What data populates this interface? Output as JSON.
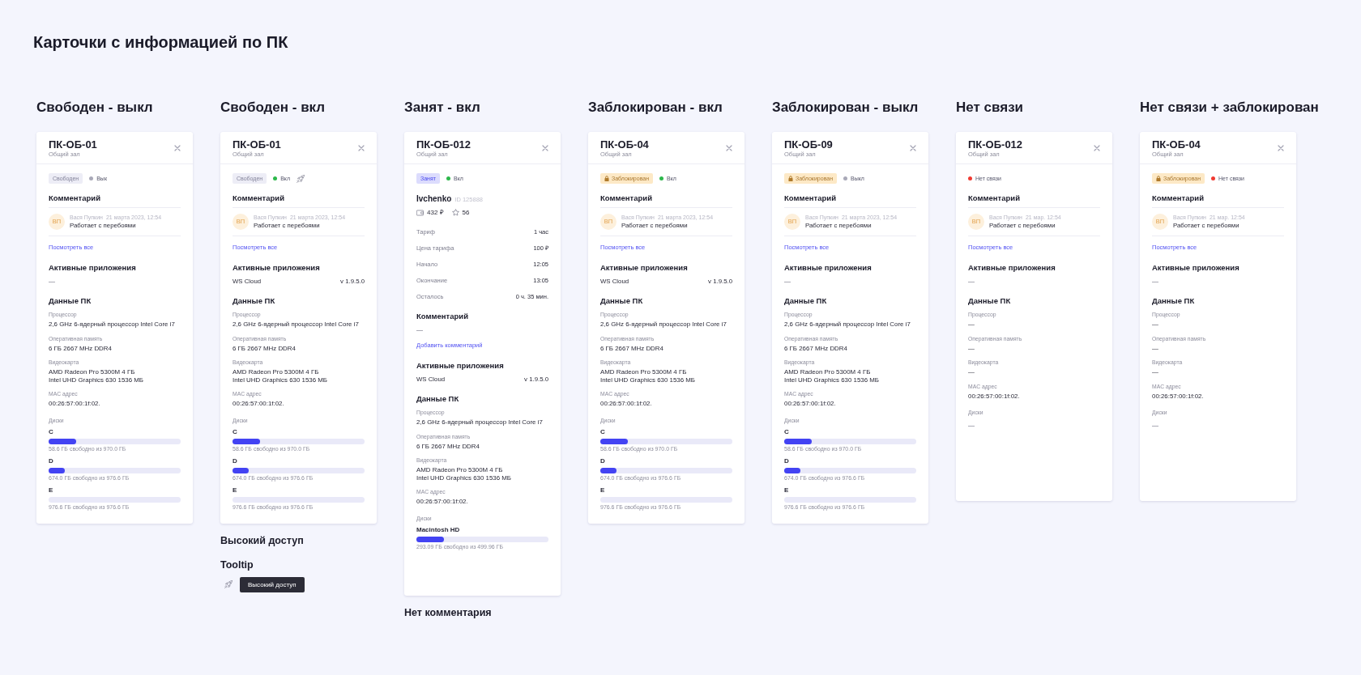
{
  "title": "Карточки с информацией по ПК",
  "columns": [
    {
      "heading": "Свободен - выкл",
      "card": {
        "title": "ПК-ОБ-01",
        "subtitle": "Общий зал",
        "badge": {
          "kind": "free",
          "label": "Свободен"
        },
        "connection": {
          "label": "Вык",
          "color": "#a9a9b8"
        },
        "high_access": false,
        "comment_heading": "Комментарий",
        "comments": [
          {
            "initials": "ВП",
            "author": "Вася Пупкин",
            "date": "21 марта 2023, 12:54",
            "text": "Работает с перебоями"
          }
        ],
        "comment_link": "Посмотреть все",
        "apps_heading": "Активные приложения",
        "apps_none": "—",
        "specs_heading": "Данные ПК",
        "specs": [
          {
            "label": "Процессор",
            "value": "2,6 GHz 6-ядерный процессор Intel Core i7"
          },
          {
            "label": "Оперативная память",
            "value": "6 ГБ 2667 MHz DDR4"
          },
          {
            "label": "Видеокарта",
            "value": "AMD Radeon Pro 5300M 4 ГБ\nIntel UHD Graphics 630 1536 МБ"
          },
          {
            "label": "MAC адрес",
            "value": "00:26:57:00:1f:02."
          }
        ],
        "disks_label": "Диски",
        "disks": [
          {
            "name": "C",
            "level": 0.21,
            "caption": "58.6 ГБ свободно из 970.0 ГБ"
          },
          {
            "name": "D",
            "level": 0.12,
            "caption": "674.0 ГБ свободно из 976.6 ГБ"
          },
          {
            "name": "E",
            "level": 0,
            "caption": "976.6 ГБ свободно из 976.6 ГБ"
          }
        ]
      }
    },
    {
      "heading": "Свободен - вкл",
      "card": {
        "title": "ПК-ОБ-01",
        "subtitle": "Общий зал",
        "badge": {
          "kind": "free",
          "label": "Свободен"
        },
        "connection": {
          "label": "Вкл",
          "color": "#2db84b"
        },
        "high_access": true,
        "comment_heading": "Комментарий",
        "comments": [
          {
            "initials": "ВП",
            "author": "Вася Пупкин",
            "date": "21 марта 2023, 12:54",
            "text": "Работает с перебоями"
          }
        ],
        "comment_link": "Посмотреть все",
        "apps_heading": "Активные приложения",
        "apps": [
          {
            "name": "WS Cloud",
            "version": "v 1.9.5.0"
          }
        ],
        "specs_heading": "Данные ПК",
        "specs": [
          {
            "label": "Процессор",
            "value": "2,6 GHz 6-ядерный процессор Intel Core i7"
          },
          {
            "label": "Оперативная память",
            "value": "6 ГБ 2667 MHz DDR4"
          },
          {
            "label": "Видеокарта",
            "value": "AMD Radeon Pro 5300M 4 ГБ\nIntel UHD Graphics 630 1536 МБ"
          },
          {
            "label": "MAC адрес",
            "value": "00:26:57:00:1f:02."
          }
        ],
        "disks_label": "Диски",
        "disks": [
          {
            "name": "C",
            "level": 0.21,
            "caption": "58.6 ГБ свободно из 970.0 ГБ"
          },
          {
            "name": "D",
            "level": 0.12,
            "caption": "674.0 ГБ свободно из 976.6 ГБ"
          },
          {
            "name": "E",
            "level": 0,
            "caption": "976.6 ГБ свободно из 976.6 ГБ"
          }
        ]
      },
      "notes": [
        {
          "kind": "heading",
          "text": "Высокий доступ"
        },
        {
          "kind": "heading",
          "text": "Tooltip"
        },
        {
          "kind": "tooltip",
          "text": "Высокий доступ"
        }
      ]
    },
    {
      "heading": "Занят - вкл",
      "card": {
        "title": "ПК-ОБ-012",
        "subtitle": "Общий зал",
        "badge": {
          "kind": "busy",
          "label": "Занят"
        },
        "connection": {
          "label": "Вкл",
          "color": "#2db84b"
        },
        "high_access": false,
        "user": {
          "name": "Ivchenko",
          "id": "ID 125888",
          "balance": "432 ₽",
          "score": "56"
        },
        "session": [
          {
            "label": "Тариф",
            "value": "1 час"
          },
          {
            "label": "Цена тарифа",
            "value": "100 ₽"
          },
          {
            "label": "Начало",
            "value": "12:05"
          },
          {
            "label": "Окончание",
            "value": "13:05"
          },
          {
            "label": "Осталось",
            "value": "0 ч. 35 мин."
          }
        ],
        "comment_heading": "Комментарий",
        "comment_none": "—",
        "comment_link": "Добавить комментарий",
        "apps_heading": "Активные приложения",
        "apps": [
          {
            "name": "WS Cloud",
            "version": "v 1.9.5.0"
          }
        ],
        "specs_heading": "Данные ПК",
        "specs": [
          {
            "label": "Процессор",
            "value": "2,6 GHz 6-ядерный процессор Intel Core i7"
          },
          {
            "label": "Оперативная память",
            "value": "6 ГБ 2667 MHz DDR4"
          },
          {
            "label": "Видеокарта",
            "value": "AMD Radeon Pro 5300M 4 ГБ\nIntel UHD Graphics 630 1536 МБ"
          },
          {
            "label": "MAC адрес",
            "value": "00:26:57:00:1f:02."
          }
        ],
        "disks_label": "Диски",
        "disks": [
          {
            "name": "Macintosh HD",
            "level": 0.21,
            "caption": "293.09 ГБ свободно из 499.96 ГБ"
          }
        ]
      },
      "notes": [
        {
          "kind": "heading",
          "text": "Нет комментария"
        }
      ]
    },
    {
      "heading": "Заблокирован - вкл",
      "card": {
        "title": "ПК-ОБ-04",
        "subtitle": "Общий зал",
        "badge": {
          "kind": "blocked",
          "label": "Заблокирован"
        },
        "connection": {
          "label": "Вкл",
          "color": "#2db84b"
        },
        "high_access": false,
        "comment_heading": "Комментарий",
        "comments": [
          {
            "initials": "ВП",
            "author": "Вася Пупкин",
            "date": "21 марта 2023, 12:54",
            "text": "Работает с перебоями"
          }
        ],
        "comment_link": "Посмотреть все",
        "apps_heading": "Активные приложения",
        "apps": [
          {
            "name": "WS Cloud",
            "version": "v 1.9.5.0"
          }
        ],
        "specs_heading": "Данные ПК",
        "specs": [
          {
            "label": "Процессор",
            "value": "2,6 GHz 6-ядерный процессор Intel Core i7"
          },
          {
            "label": "Оперативная память",
            "value": "6 ГБ 2667 MHz DDR4"
          },
          {
            "label": "Видеокарта",
            "value": "AMD Radeon Pro 5300M 4 ГБ\nIntel UHD Graphics 630 1536 МБ"
          },
          {
            "label": "MAC адрес",
            "value": "00:26:57:00:1f:02."
          }
        ],
        "disks_label": "Диски",
        "disks": [
          {
            "name": "C",
            "level": 0.21,
            "caption": "58.6 ГБ свободно из 970.0 ГБ"
          },
          {
            "name": "D",
            "level": 0.12,
            "caption": "674.0 ГБ свободно из 976.6 ГБ"
          },
          {
            "name": "E",
            "level": 0,
            "caption": "976.6 ГБ свободно из 976.6 ГБ"
          }
        ]
      }
    },
    {
      "heading": "Заблокирован - выкл",
      "card": {
        "title": "ПК-ОБ-09",
        "subtitle": "Общий зал",
        "badge": {
          "kind": "blocked",
          "label": "Заблокирован"
        },
        "connection": {
          "label": "Выкл",
          "color": "#a9a9b8"
        },
        "high_access": false,
        "comment_heading": "Комментарий",
        "comments": [
          {
            "initials": "ВП",
            "author": "Вася Пупкин",
            "date": "21 марта 2023, 12:54",
            "text": "Работает с перебоями"
          }
        ],
        "comment_link": "Посмотреть все",
        "apps_heading": "Активные приложения",
        "apps_none": "—",
        "specs_heading": "Данные ПК",
        "specs": [
          {
            "label": "Процессор",
            "value": "2,6 GHz 6-ядерный процессор Intel Core i7"
          },
          {
            "label": "Оперативная память",
            "value": "6 ГБ 2667 MHz DDR4"
          },
          {
            "label": "Видеокарта",
            "value": "AMD Radeon Pro 5300M 4 ГБ\nIntel UHD Graphics 630 1536 МБ"
          },
          {
            "label": "MAC адрес",
            "value": "00:26:57:00:1f:02."
          }
        ],
        "disks_label": "Диски",
        "disks": [
          {
            "name": "C",
            "level": 0.21,
            "caption": "58.6 ГБ свободно из 970.0 ГБ"
          },
          {
            "name": "D",
            "level": 0.12,
            "caption": "674.0 ГБ свободно из 976.6 ГБ"
          },
          {
            "name": "E",
            "level": 0,
            "caption": "976.6 ГБ свободно из 976.6 ГБ"
          }
        ]
      }
    },
    {
      "heading": "Нет связи",
      "card": {
        "title": "ПК-ОБ-012",
        "subtitle": "Общий зал",
        "connection": {
          "label": "Нет связи",
          "color": "#f03a32"
        },
        "high_access": false,
        "comment_heading": "Комментарий",
        "comments": [
          {
            "initials": "ВП",
            "author": "Вася Пупкин",
            "date": "21 мар. 12:54",
            "text": "Работает с перебоями"
          }
        ],
        "comment_link": "Посмотреть все",
        "apps_heading": "Активные приложения",
        "apps_none": "—",
        "specs_heading": "Данные ПК",
        "specs": [
          {
            "label": "Процессор",
            "value": "—"
          },
          {
            "label": "Оперативная память",
            "value": "—"
          },
          {
            "label": "Видеокарта",
            "value": "—"
          },
          {
            "label": "MAC адрес",
            "value": "00:26:57:00:1f:02."
          }
        ],
        "disks_label": "Диски",
        "disks_none": "—"
      }
    },
    {
      "heading": "Нет связи + заблокирован",
      "card": {
        "title": "ПК-ОБ-04",
        "subtitle": "Общий зал",
        "badge": {
          "kind": "blocked",
          "label": "Заблокирован"
        },
        "connection": {
          "label": "Нет связи",
          "color": "#f03a32"
        },
        "high_access": false,
        "comment_heading": "Комментарий",
        "comments": [
          {
            "initials": "ВП",
            "author": "Вася Пупкин",
            "date": "21 мар. 12:54",
            "text": "Работает с перебоями"
          }
        ],
        "comment_link": "Посмотреть все",
        "apps_heading": "Активные приложения",
        "apps_none": "—",
        "specs_heading": "Данные ПК",
        "specs": [
          {
            "label": "Процессор",
            "value": "—"
          },
          {
            "label": "Оперативная память",
            "value": "—"
          },
          {
            "label": "Видеокарта",
            "value": "—"
          },
          {
            "label": "MAC адрес",
            "value": "00:26:57:00:1f:02."
          }
        ],
        "disks_label": "Диски",
        "disks_none": "—"
      }
    }
  ]
}
